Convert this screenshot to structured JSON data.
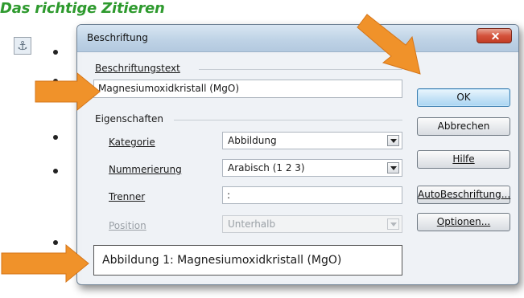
{
  "document": {
    "heading": "Das richtige Zitieren"
  },
  "dialog": {
    "title": "Beschriftung",
    "caption_text_label": "Beschriftungstext",
    "caption_text_value": "Magnesiumoxidkristall (MgO)",
    "properties_label": "Eigenschaften",
    "category_label": "Kategorie",
    "category_value": "Abbildung",
    "numbering_label": "Nummerierung",
    "numbering_value": "Arabisch (1 2 3)",
    "separator_label": "Trenner",
    "separator_value": ":",
    "position_label": "Position",
    "position_value": "Unterhalb",
    "preview_text": "Abbildung 1: Magnesiumoxidkristall (MgO)",
    "buttons": {
      "ok": "OK",
      "cancel": "Abbrechen",
      "help": "Hilfe",
      "auto_caption": "AutoBeschriftung...",
      "options": "Optionen..."
    }
  },
  "colors": {
    "heading": "#2e9a2e",
    "arrow": "#f0922a",
    "close_button": "#c8432b",
    "default_button": "#a8d4f2"
  },
  "icons": [
    "anchor-icon",
    "close-icon",
    "dropdown-arrow-icon",
    "annotation-arrow"
  ]
}
